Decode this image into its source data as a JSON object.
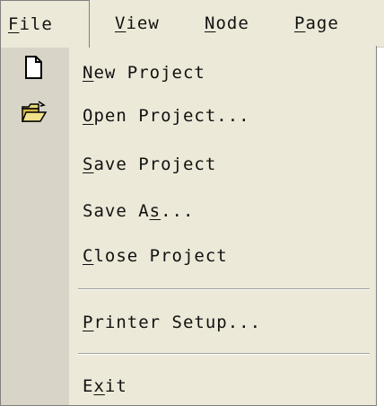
{
  "menubar": {
    "items": [
      {
        "pre": "",
        "key": "F",
        "post": "ile"
      },
      {
        "pre": "",
        "key": "V",
        "post": "iew"
      },
      {
        "pre": "",
        "key": "N",
        "post": "ode"
      },
      {
        "pre": "",
        "key": "P",
        "post": "age"
      }
    ]
  },
  "file_menu": {
    "items": [
      {
        "pre": "",
        "key": "N",
        "post": "ew Project",
        "icon": "new-document-icon"
      },
      {
        "pre": "",
        "key": "O",
        "post": "pen Project...",
        "icon": "open-folder-icon"
      },
      {
        "pre": "",
        "key": "S",
        "post": "ave Project"
      },
      {
        "pre": "Save A",
        "key": "s",
        "post": "..."
      },
      {
        "pre": "",
        "key": "C",
        "post": "lose Project"
      },
      {
        "pre": "",
        "key": "P",
        "post": "rinter Setup..."
      },
      {
        "pre": "E",
        "key": "x",
        "post": "it"
      }
    ]
  }
}
